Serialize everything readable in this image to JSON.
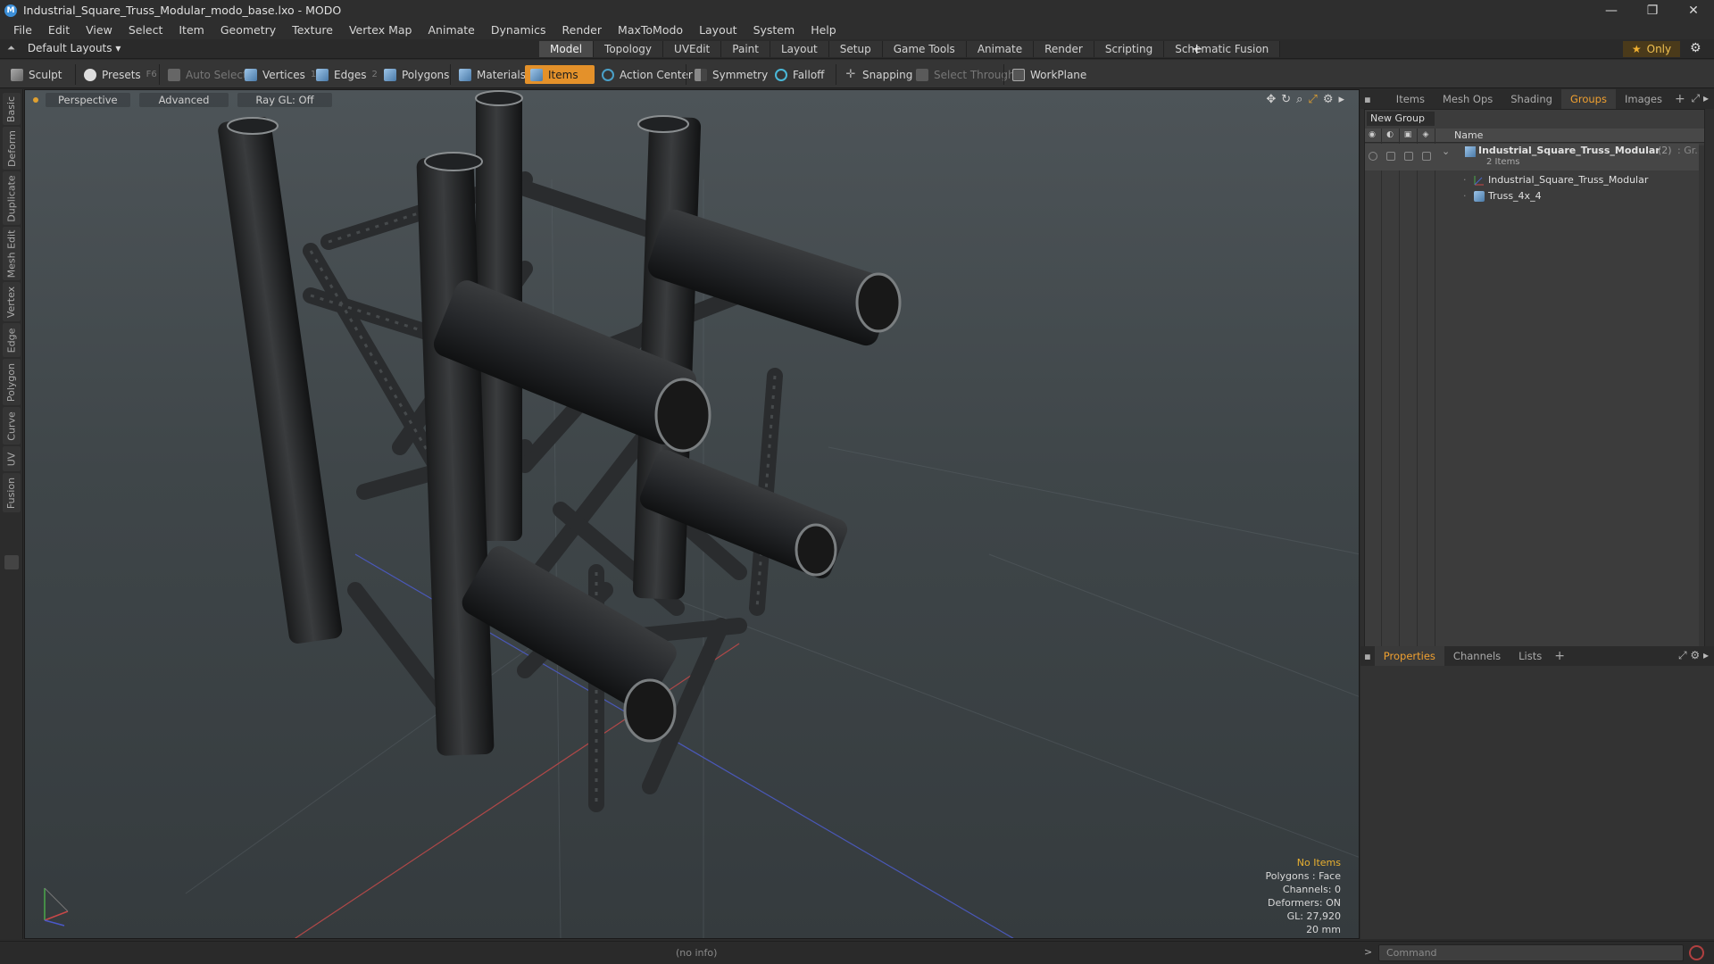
{
  "window": {
    "title": "Industrial_Square_Truss_Modular_modo_base.lxo - MODO",
    "minimize": "—",
    "maximize": "❐",
    "close": "✕"
  },
  "menu": [
    "File",
    "Edit",
    "View",
    "Select",
    "Item",
    "Geometry",
    "Texture",
    "Vertex Map",
    "Animate",
    "Dynamics",
    "Render",
    "MaxToModo",
    "Layout",
    "System",
    "Help"
  ],
  "layout": {
    "selector": "Default Layouts ▾",
    "tabs": [
      "Model",
      "Topology",
      "UVEdit",
      "Paint",
      "Layout",
      "Setup",
      "Game Tools",
      "Animate",
      "Render",
      "Scripting",
      "Schematic Fusion"
    ],
    "active_tab": "Model",
    "add": "+",
    "only_label": "Only"
  },
  "toolbar": {
    "sculpt": "Sculpt",
    "presets": "Presets",
    "presets_key": "F6",
    "auto_select": "Auto Select",
    "vertices": "Vertices",
    "vertices_key": "1",
    "edges": "Edges",
    "edges_key": "2",
    "polygons": "Polygons",
    "materials": "Materials",
    "items": "Items",
    "action_center": "Action Center",
    "symmetry": "Symmetry",
    "falloff": "Falloff",
    "snapping": "Snapping",
    "select_through": "Select Through",
    "workplane": "WorkPlane"
  },
  "left_tabs": [
    "Basic",
    "Deform",
    "Duplicate",
    "Mesh Edit",
    "Vertex",
    "Edge",
    "Polygon",
    "Curve",
    "UV",
    "Fusion"
  ],
  "viewport": {
    "view": "Perspective",
    "shading": "Advanced",
    "raygl": "Ray GL: Off",
    "info": {
      "items": "No Items",
      "polygons": "Polygons : Face",
      "channels": "Channels: 0",
      "deformers": "Deformers: ON",
      "gl": "GL: 27,920",
      "scale": "20 mm"
    }
  },
  "status": {
    "info": "(no info)",
    "command_placeholder": "Command",
    "prompt": ">"
  },
  "right_panel": {
    "top_tabs": [
      "Items",
      "Mesh Ops",
      "Shading",
      "Groups",
      "Images"
    ],
    "top_active": "Groups",
    "new_group": "New Group",
    "col_name": "Name",
    "group": {
      "name": "Industrial_Square_Truss_Modular",
      "count": "(2)",
      "suffix": ": Gr...",
      "subtitle": "2 Items",
      "children": [
        "Industrial_Square_Truss_Modular",
        "Truss_4x_4"
      ]
    },
    "bottom_tabs": [
      "Properties",
      "Channels",
      "Lists"
    ],
    "bottom_active": "Properties"
  },
  "colors": {
    "accent": "#e4912a",
    "viewport_top": "#4d5458",
    "viewport_bottom": "#353b3e"
  }
}
